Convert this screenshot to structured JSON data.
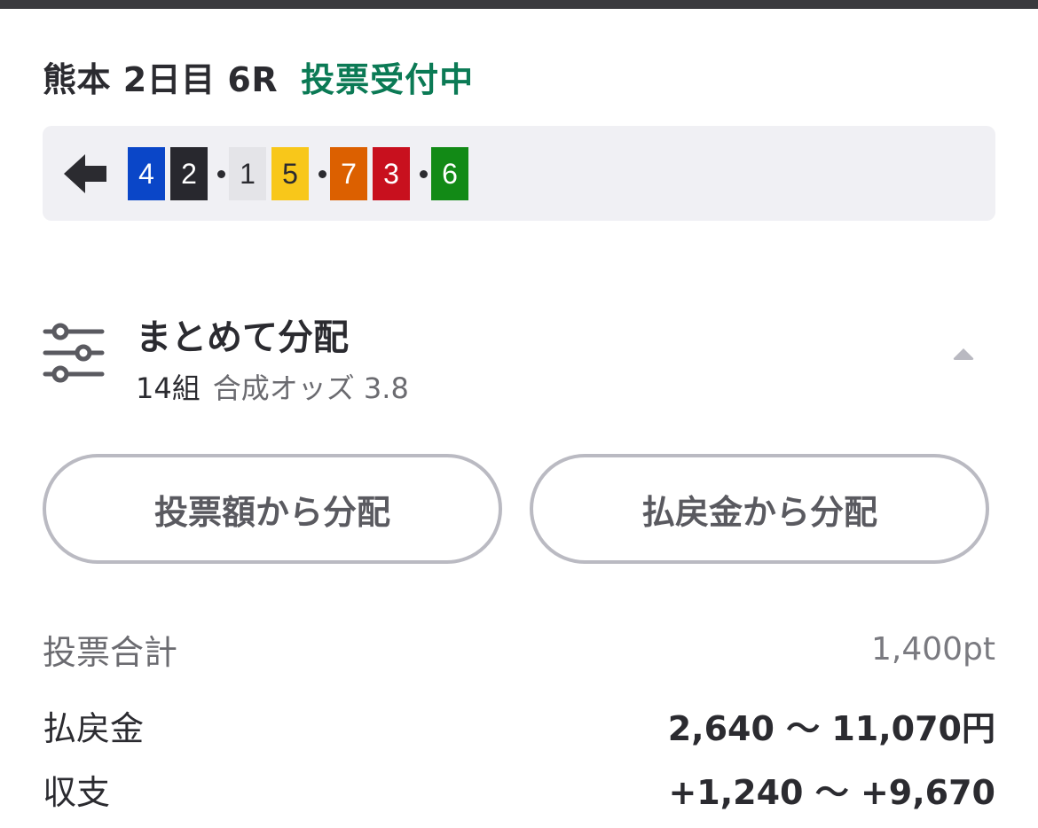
{
  "race": {
    "title": "熊本 2日目 6R",
    "status": "投票受付中",
    "status_color": "#0b7a55"
  },
  "order": {
    "direction_icon": "arrow-left-icon",
    "groups": [
      [
        {
          "num": "4",
          "bg": "#0a46c8",
          "fg": "#ffffff"
        },
        {
          "num": "2",
          "bg": "#28282e",
          "fg": "#ffffff"
        }
      ],
      [
        {
          "num": "1",
          "bg": "#e4e4e8",
          "fg": "#2b2b30"
        },
        {
          "num": "5",
          "bg": "#f8c71a",
          "fg": "#2b2b30"
        }
      ],
      [
        {
          "num": "7",
          "bg": "#dc6000",
          "fg": "#ffffff"
        },
        {
          "num": "3",
          "bg": "#c8101e",
          "fg": "#ffffff"
        }
      ],
      [
        {
          "num": "6",
          "bg": "#128a16",
          "fg": "#ffffff"
        }
      ]
    ]
  },
  "distribution": {
    "icon": "sliders-icon",
    "title": "まとめて分配",
    "combinations": "14組",
    "odds_label": "合成オッズ 3.8",
    "toggle_icon": "chevron-up-icon"
  },
  "buttons": {
    "by_stake": "投票額から分配",
    "by_payout": "払戻金から分配"
  },
  "summary": {
    "total_label": "投票合計",
    "total_value": "1,400pt",
    "payout_label": "払戻金",
    "payout_value": "2,640 〜 11,070円",
    "balance_label": "収支",
    "balance_value": "+1,240 〜 +9,670"
  }
}
